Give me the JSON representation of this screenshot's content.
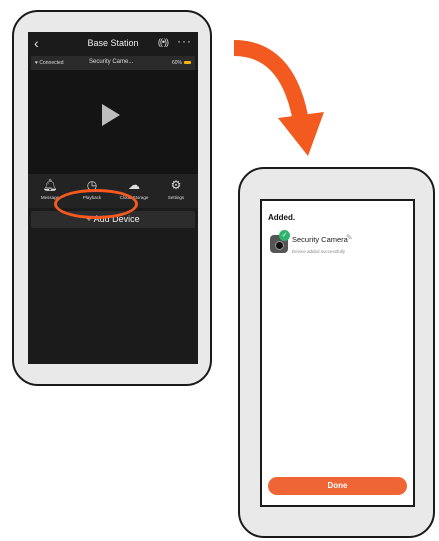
{
  "left_screen": {
    "nav": {
      "back_glyph": "‹",
      "title": "Base Station",
      "wifi_glyph": "((•))",
      "more_glyph": "···"
    },
    "status": {
      "connection": "Connected",
      "device_name": "Security Came...",
      "battery": "60%"
    },
    "toolbar": [
      {
        "icon": "bell-icon",
        "glyph": "♫",
        "label": "Message"
      },
      {
        "icon": "playback-icon",
        "glyph": "◷",
        "label": "Playback"
      },
      {
        "icon": "cloud-icon",
        "glyph": "☁",
        "label": "Cloud Storage"
      },
      {
        "icon": "settings-icon",
        "glyph": "⚙",
        "label": "Settings"
      }
    ],
    "add_device_label": "+ Add Device"
  },
  "right_screen": {
    "title": "Added.",
    "device_name": "Security Camera",
    "device_status": "Device added successfully",
    "check_glyph": "✓",
    "edit_glyph": "✎",
    "done_label": "Done"
  },
  "colors": {
    "accent": "#f25a1f",
    "done_button": "#ef6536",
    "success": "#2fb36e",
    "app_dark": "#1b1b1b"
  }
}
